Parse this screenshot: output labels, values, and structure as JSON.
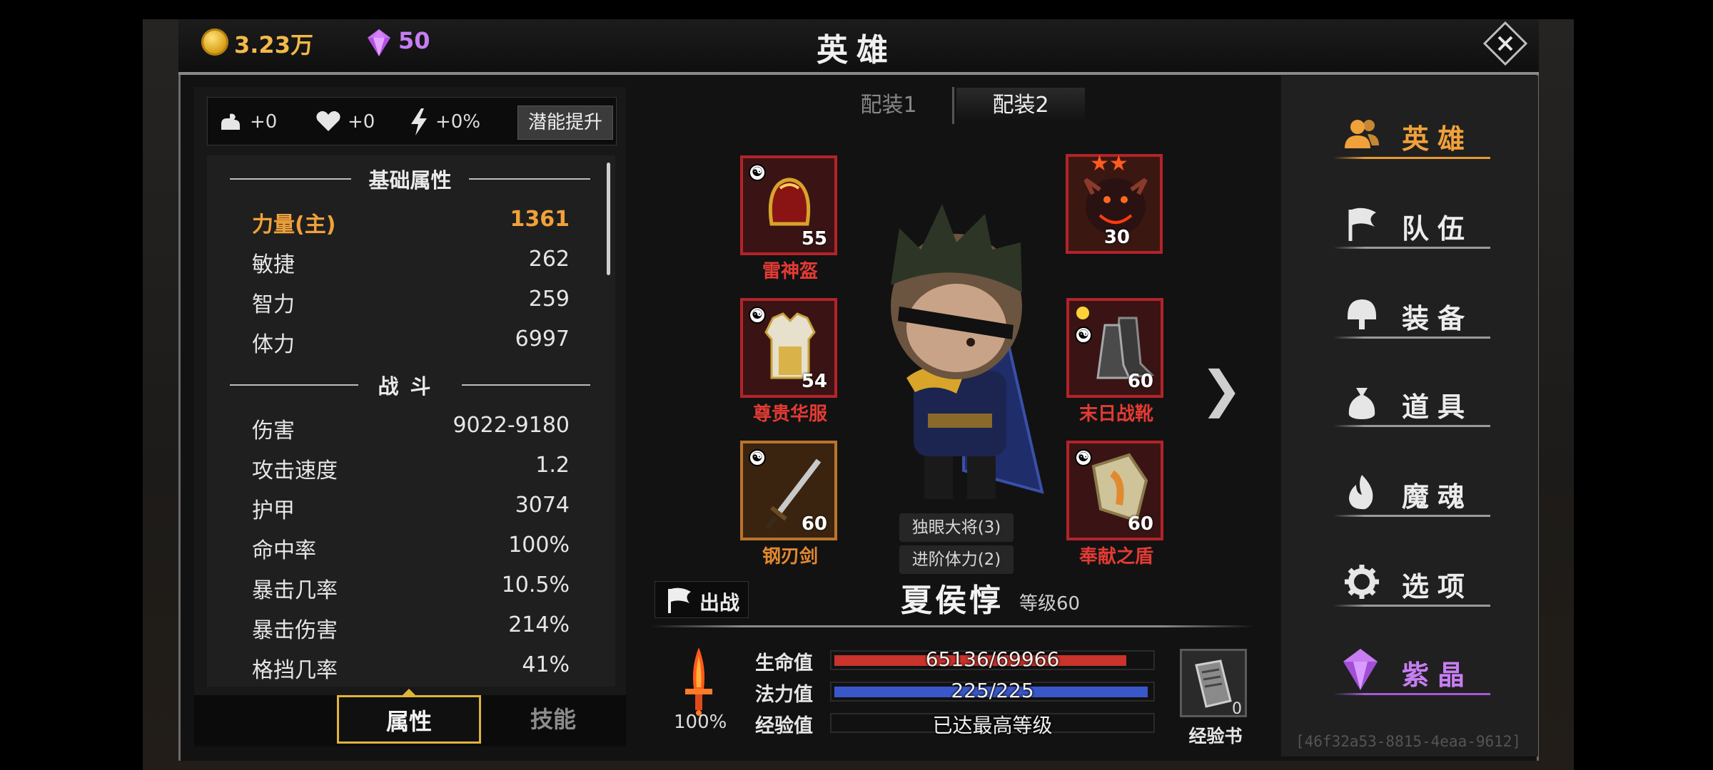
{
  "header": {
    "gold": "3.23万",
    "gems": "50",
    "title": "英雄"
  },
  "potential": {
    "strength_bonus": "+0",
    "health_bonus": "+0",
    "energy_bonus": "+0%",
    "button": "潜能提升"
  },
  "stats": {
    "basic_title": "基础属性",
    "basic": [
      {
        "name": "力量(主)",
        "value": "1361"
      },
      {
        "name": "敏捷",
        "value": "262"
      },
      {
        "name": "智力",
        "value": "259"
      },
      {
        "name": "体力",
        "value": "6997"
      }
    ],
    "combat_title": "战斗",
    "combat": [
      {
        "name": "伤害",
        "value": "9022-9180"
      },
      {
        "name": "攻击速度",
        "value": "1.2"
      },
      {
        "name": "护甲",
        "value": "3074"
      },
      {
        "name": "命中率",
        "value": "100%"
      },
      {
        "name": "暴击几率",
        "value": "10.5%"
      },
      {
        "name": "暴击伤害",
        "value": "214%"
      },
      {
        "name": "格挡几率",
        "value": "41%"
      }
    ]
  },
  "bottom_tabs": {
    "attributes": "属性",
    "skills": "技能"
  },
  "loadout": {
    "tab1": "配装1",
    "tab2": "配装2"
  },
  "equipment": [
    {
      "name": "雷神盔",
      "level": "55"
    },
    {
      "name": "",
      "level": "30"
    },
    {
      "name": "尊贵华服",
      "level": "54"
    },
    {
      "name": "末日战靴",
      "level": "60"
    },
    {
      "name": "钢刃剑",
      "level": "60"
    },
    {
      "name": "奉献之盾",
      "level": "60"
    }
  ],
  "set_bonuses": [
    "独眼大将(3)",
    "进阶体力(2)"
  ],
  "hero": {
    "deploy": "出战",
    "name": "夏侯惇",
    "level": "等级60",
    "sword_percent": "100%"
  },
  "vitals": {
    "hp_label": "生命值",
    "hp_value": "65136/69966",
    "hp_current": 65136,
    "hp_max": 69966,
    "mp_label": "法力值",
    "mp_value": "225/225",
    "mp_current": 225,
    "mp_max": 225,
    "exp_label": "经验值",
    "exp_value": "已达最高等级"
  },
  "exp_book": {
    "count": "0",
    "label": "经验书"
  },
  "nav": [
    {
      "label": "英雄",
      "icon": "hero-icon"
    },
    {
      "label": "队伍",
      "icon": "flag-icon"
    },
    {
      "label": "装备",
      "icon": "helmet-icon"
    },
    {
      "label": "道具",
      "icon": "bag-icon"
    },
    {
      "label": "魔魂",
      "icon": "flame-icon"
    },
    {
      "label": "选项",
      "icon": "gear-icon"
    },
    {
      "label": "紫晶",
      "icon": "crystal-icon"
    }
  ],
  "session_id": "[46f32a53-8815-4eaa-9612]",
  "colors": {
    "gold": "#f2b94a",
    "purple": "#c77ef2",
    "active_orange": "#f0a13a",
    "item_red": "#e33b34",
    "hp_bar": "#c9332b",
    "mp_bar": "#3a57c9"
  }
}
